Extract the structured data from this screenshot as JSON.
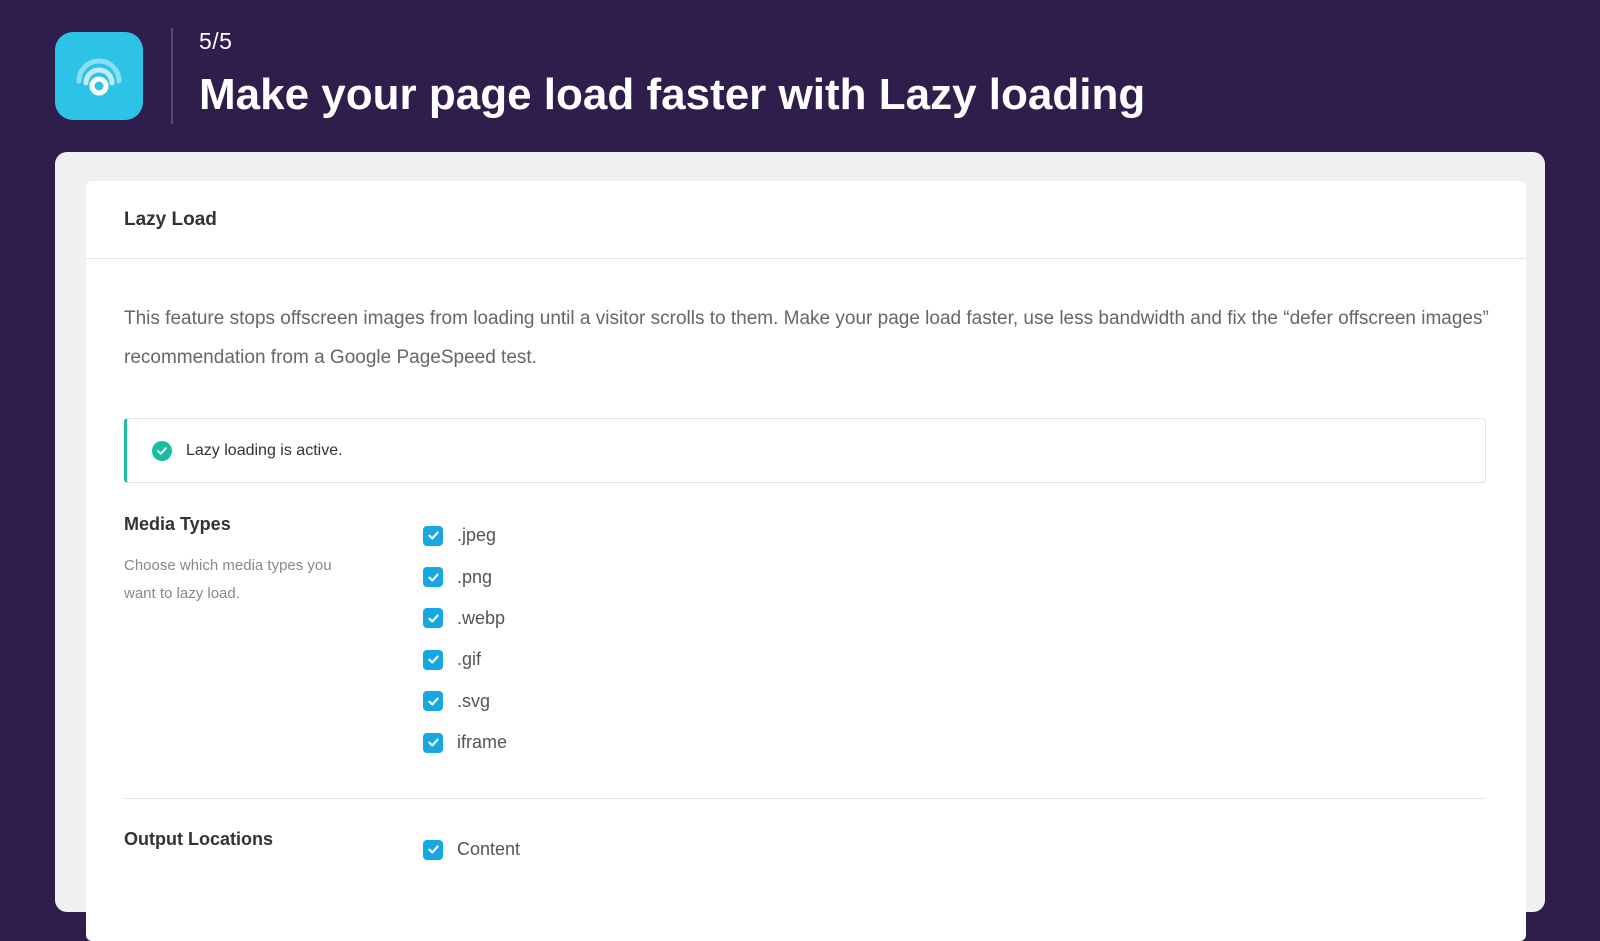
{
  "header": {
    "step": "5/5",
    "title": "Make your page load faster with Lazy loading"
  },
  "card": {
    "title": "Lazy Load",
    "description": "This feature stops offscreen images from loading until a visitor scrolls to them. Make your page load faster, use less bandwidth and fix the “defer offscreen images” recommendation from a Google PageSpeed test.",
    "notice": {
      "text": "Lazy loading is active.",
      "status": "success",
      "color": "#17bfa0"
    }
  },
  "media_types": {
    "label": "Media Types",
    "help": "Choose which media types you want to lazy load.",
    "options": [
      {
        "label": ".jpeg",
        "checked": true
      },
      {
        "label": ".png",
        "checked": true
      },
      {
        "label": ".webp",
        "checked": true
      },
      {
        "label": ".gif",
        "checked": true
      },
      {
        "label": ".svg",
        "checked": true
      },
      {
        "label": "iframe",
        "checked": true
      }
    ]
  },
  "output_locations": {
    "label": "Output Locations",
    "options": [
      {
        "label": "Content",
        "checked": true
      }
    ]
  },
  "colors": {
    "background": "#2f1d4b",
    "logo": "#2cc3e6",
    "checkbox": "#17a8e3",
    "success": "#17bfa0"
  },
  "icons": {
    "logo": "concentric-circles-icon",
    "notice": "check-circle-icon",
    "checkbox": "checkmark-icon"
  }
}
